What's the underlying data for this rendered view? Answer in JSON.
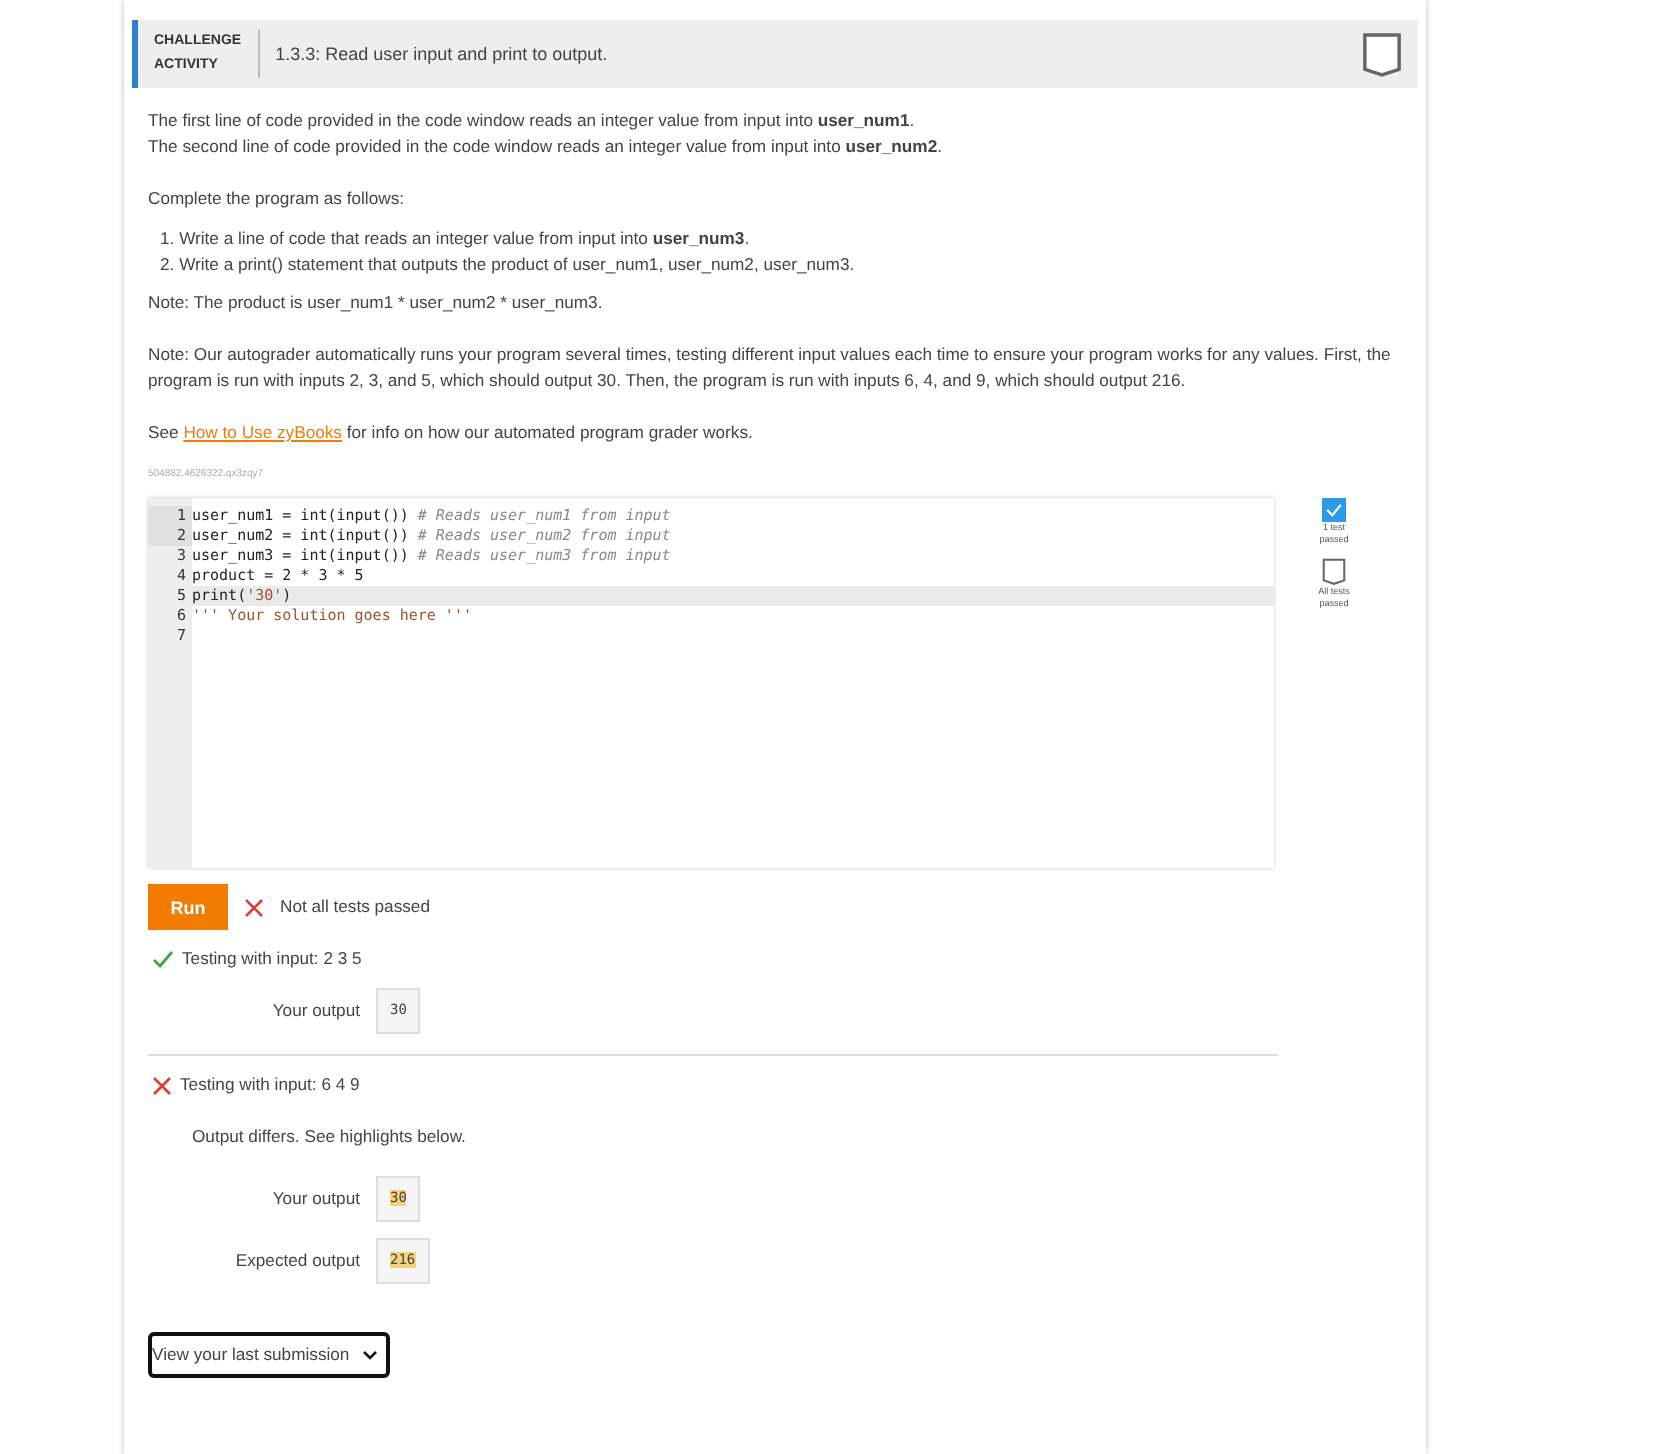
{
  "header": {
    "badge_line1": "CHALLENGE",
    "badge_line2": "ACTIVITY",
    "title": "1.3.3: Read user input and print to output.",
    "completed": false
  },
  "instructions": {
    "paragraphs": [
      "The first line of code provided in the code window reads an integer value from input into **user_num1**.",
      "The second line of code provided in the code window reads an integer value from input into **user_num2**."
    ],
    "intro": "Complete the program as follows:",
    "steps": [
      {
        "number": "1.",
        "text": "Write a line of code that reads an integer value from input into **user_num3**."
      },
      {
        "number": "2.",
        "text": "Write a print() statement that outputs the product of user_num1, user_num2, user_num3."
      }
    ],
    "note1": "Note: The product is user_num1 * user_num2 * user_num3.",
    "note2": "Note: Our autograder automatically runs your program several times, testing different input values each time to ensure your program works for any values. First, the program is run with inputs 2, 3, and 5, which should output 30. Then, the program is run with inputs 6, 4, and 9, which should output 216.",
    "see_before": "See",
    "link": "How to Use zyBooks",
    "see_after": "for info on how our automated program grader works."
  },
  "activity_id": "504882.4626322.qx3zqy7",
  "editor": {
    "lines": [
      {
        "number": "1",
        "active": false,
        "segments": [
          {
            "kind": "code",
            "text": "user_num1 = int(input()) "
          },
          {
            "kind": "comment",
            "text": "# Reads user_num1 from input"
          }
        ]
      },
      {
        "number": "2",
        "active": false,
        "segments": [
          {
            "kind": "code",
            "text": "user_num2 = int(input()) "
          },
          {
            "kind": "comment",
            "text": "# Reads user_num2 from input"
          }
        ]
      },
      {
        "number": "3",
        "active": false,
        "segments": [
          {
            "kind": "code",
            "text": "user_num3 = int(input()) "
          },
          {
            "kind": "comment",
            "text": "# Reads user_num3 from input"
          }
        ]
      },
      {
        "number": "4",
        "active": false,
        "segments": [
          {
            "kind": "code",
            "text": "product = 2 * 3 * 5"
          }
        ]
      },
      {
        "number": "5",
        "active": true,
        "segments": [
          {
            "kind": "code",
            "text": "print("
          },
          {
            "kind": "string",
            "text": "'30'"
          },
          {
            "kind": "code",
            "text": ")"
          }
        ]
      },
      {
        "number": "6",
        "active": false,
        "segments": [
          {
            "kind": "string",
            "text": "''' Your solution goes here '''"
          }
        ]
      },
      {
        "number": "7",
        "active": false
      }
    ]
  },
  "progress": [
    {
      "label": "1 test passed",
      "done": true
    },
    {
      "label": "All tests passed",
      "done": false
    }
  ],
  "run_button": "Run",
  "result": {
    "passed": false,
    "text": "Not all tests passed"
  },
  "tests": [
    {
      "passed": true,
      "title": "Testing with input: 2 3 5",
      "outputs": [
        {
          "label": "Your output",
          "value": "30",
          "highlighted": false
        }
      ]
    },
    {
      "passed": false,
      "title": "Testing with input: 6 4 9",
      "message": "Output differs. See highlights below.",
      "outputs": [
        {
          "label": "Your output",
          "value": "30",
          "highlighted": true
        },
        {
          "label": "Expected output",
          "value": "216",
          "highlighted": true
        }
      ]
    }
  ],
  "submission_select": "View your last submission"
}
